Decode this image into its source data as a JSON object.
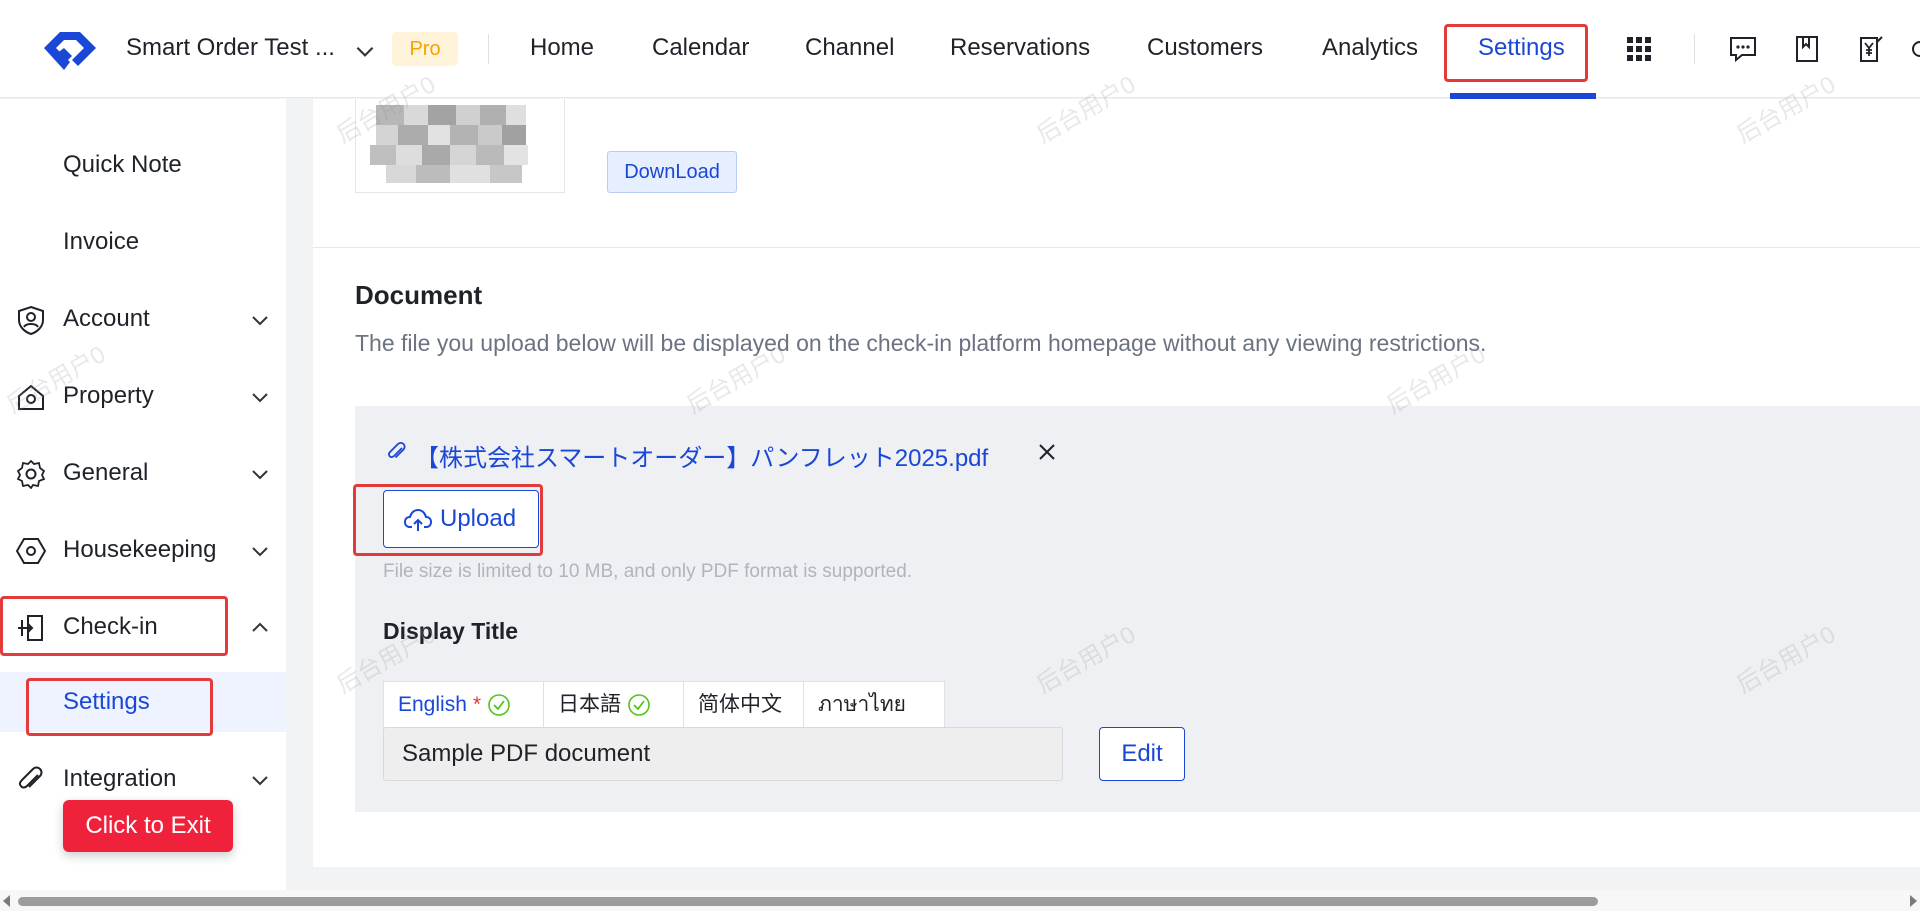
{
  "header": {
    "store_name": "Smart Order Test ...",
    "plan_badge": "Pro",
    "nav": [
      "Home",
      "Calendar",
      "Channel",
      "Reservations",
      "Customers",
      "Analytics",
      "Settings"
    ],
    "active_nav": "Settings",
    "icons": [
      "apps-grid-icon",
      "chat-icon",
      "bookmark-icon",
      "yen-receipt-icon"
    ]
  },
  "sidebar": {
    "items": [
      {
        "label": "Quick Note",
        "icon": "none"
      },
      {
        "label": "Invoice",
        "icon": "none"
      },
      {
        "label": "Account",
        "icon": "user-shield-icon"
      },
      {
        "label": "Property",
        "icon": "house-icon"
      },
      {
        "label": "General",
        "icon": "gear-icon"
      },
      {
        "label": "Housekeeping",
        "icon": "hexagon-icon"
      },
      {
        "label": "Check-in",
        "icon": "door-enter-icon"
      },
      {
        "label": "Settings",
        "icon": "none"
      },
      {
        "label": "Integration",
        "icon": "paperclip-icon"
      }
    ],
    "exit_button": "Click to Exit"
  },
  "main": {
    "download_label": "DownLoad",
    "document": {
      "title": "Document",
      "description": "The file you upload below will be displayed on the check-in platform homepage without any viewing restrictions.",
      "file_name": "【株式会社スマートオーダー】パンフレット2025.pdf",
      "upload_label": "Upload",
      "hint": "File size is limited to 10 MB, and only PDF format is supported.",
      "display_title_label": "Display Title",
      "languages": [
        {
          "label": "English",
          "required": "*"
        },
        {
          "label": "日本語"
        },
        {
          "label": "简体中文"
        },
        {
          "label": "ภาษาไทย"
        }
      ],
      "title_value": "Sample PDF document",
      "edit_label": "Edit"
    }
  },
  "watermark": "后台用户0",
  "colors": {
    "accent": "#1a47d6",
    "pro_badge": "#f5a300",
    "exit_button": "#f0223b",
    "highlight": "#e33a3a",
    "check": "#52c41a"
  }
}
